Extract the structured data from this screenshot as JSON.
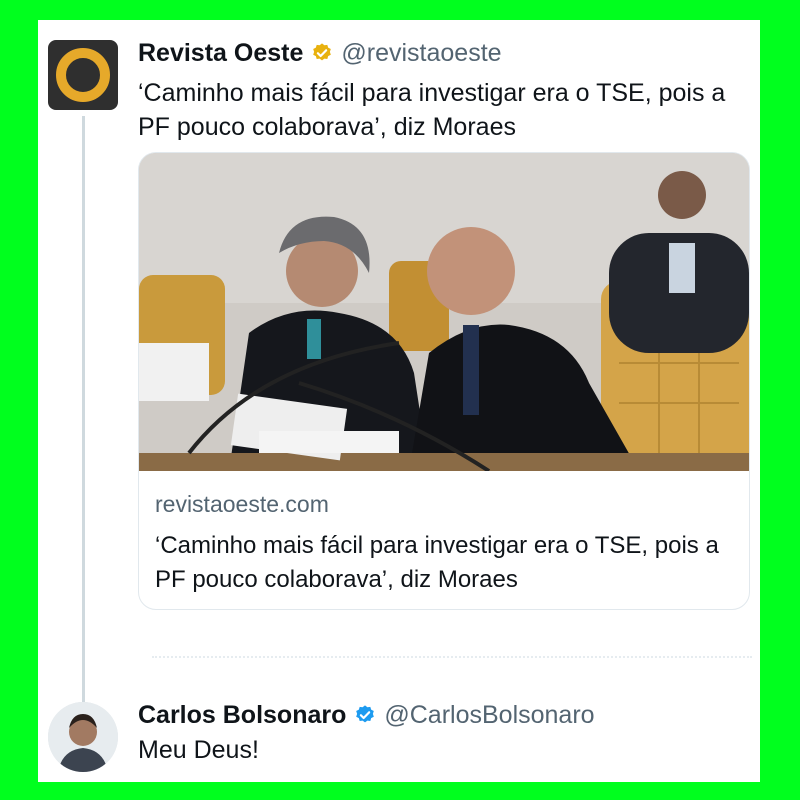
{
  "quoted_tweet": {
    "author_name": "Revista Oeste",
    "author_handle": "@revistaoeste",
    "text": "‘Caminho mais fácil para investigar era o TSE, pois a PF pouco colaborava’, diz Moraes",
    "verified_badge_color": "#e8b10e",
    "link_card": {
      "domain": "revistaoeste.com",
      "title": "‘Caminho mais fácil para investigar era o TSE, pois a PF pouco colaborava’, diz Moraes"
    }
  },
  "reply": {
    "author_name": "Carlos Bolsonaro",
    "author_handle": "@CarlosBolsonaro",
    "text": "Meu Deus!",
    "verified_badge_color": "#1d9bf0"
  },
  "colors": {
    "frame": "#00ff1e",
    "text_primary": "#0f1419",
    "text_secondary": "#536471",
    "logo_accent": "#e6a92a"
  }
}
